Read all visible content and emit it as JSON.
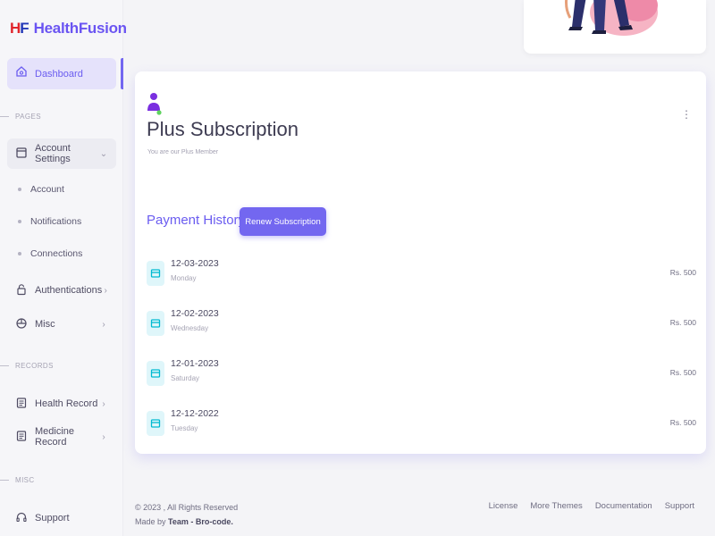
{
  "brand": {
    "logo_h": "H",
    "logo_f": "F",
    "name": "HealthFusion"
  },
  "sidebar": {
    "dashboard": {
      "label": "Dashboard",
      "icon": "home-icon"
    },
    "sections": {
      "pages": "PAGES",
      "records": "RECORDS",
      "misc": "MISC"
    },
    "account_settings": {
      "label": "Account Settings",
      "icon": "card-icon",
      "chevron": "⌄"
    },
    "sub_items": [
      "Account",
      "Notifications",
      "Connections"
    ],
    "authentications": {
      "label": "Authentications",
      "icon": "lock-icon",
      "chevron": "›"
    },
    "misc_item": {
      "label": "Misc",
      "icon": "box-icon",
      "chevron": "›"
    },
    "health_record": {
      "label": "Health Record",
      "icon": "file-icon",
      "chevron": "›"
    },
    "medicine_record": {
      "label": "Medicine Record",
      "icon": "file-icon",
      "chevron": "›"
    },
    "support": {
      "label": "Support",
      "icon": "headphones-icon"
    }
  },
  "card": {
    "title": "Plus Subscription",
    "subtitle": "You are our Plus Member",
    "kebab": "⋮",
    "payment_history_title": "Payment History",
    "renew_label": "Renew Subscription",
    "payments": [
      {
        "date": "12-03-2023",
        "day": "Monday",
        "amount": "Rs. 500"
      },
      {
        "date": "12-02-2023",
        "day": "Wednesday",
        "amount": "Rs. 500"
      },
      {
        "date": "12-01-2023",
        "day": "Saturday",
        "amount": "Rs. 500"
      },
      {
        "date": "12-12-2022",
        "day": "Tuesday",
        "amount": "Rs. 500"
      }
    ]
  },
  "footer": {
    "copyright": "© 2023 , All Rights Reserved",
    "made_by_prefix": "Made by ",
    "made_by_team": "Team - Bro-code.",
    "links": [
      "License",
      "More Themes",
      "Documentation",
      "Support"
    ]
  },
  "colors": {
    "accent": "#7367f0",
    "brand_red": "#e0242b",
    "brand_blue": "#2338b8",
    "icon_bg": "#dff6fa",
    "icon_fg": "#00bad1"
  }
}
